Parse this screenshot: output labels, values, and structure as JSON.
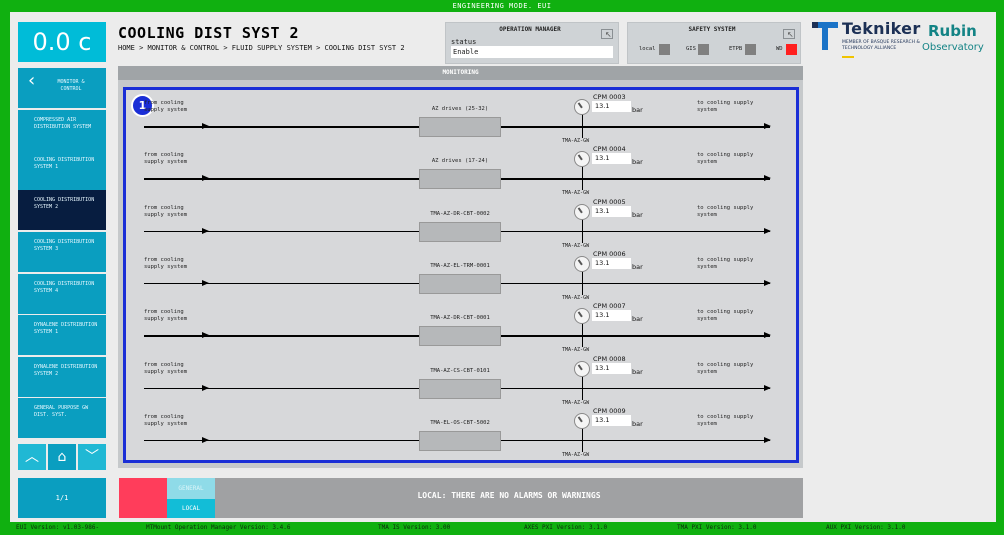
{
  "top_bar": {
    "title": "ENGINEERING MODE. EUI"
  },
  "sidebar": {
    "temperature": "0.0 c",
    "back_label": "MONITOR & CONTROL",
    "items": [
      {
        "label": "COMPRESSED AIR DISTRIBUTION SYSTEM",
        "active": false
      },
      {
        "label": "COOLING DISTRIBUTION SYSTEM 1",
        "active": false
      },
      {
        "label": "COOLING DISTRIBUTION SYSTEM 2",
        "active": true
      },
      {
        "label": "COOLING DISTRIBUTION SYSTEM 3",
        "active": false
      },
      {
        "label": "COOLING DISTRIBUTION SYSTEM 4",
        "active": false
      },
      {
        "label": "DYNALENE DISTRIBUTION SYSTEM 1",
        "active": false
      },
      {
        "label": "DYNALENE DISTRIBUTION SYSTEM 2",
        "active": false
      },
      {
        "label": "GENERAL PURPOSE GW DIST. SYST.",
        "active": false
      }
    ],
    "page_indicator": "1/1"
  },
  "header": {
    "title": "COOLING DIST SYST 2",
    "breadcrumb": "HOME > MONITOR & CONTROL > FLUID SUPPLY SYSTEM > COOLING DIST SYST 2"
  },
  "operation_manager": {
    "title": "OPERATION MANAGER",
    "status_label": "status",
    "status_value": "Enable"
  },
  "safety_system": {
    "title": "SAFETY SYSTEM",
    "indicators": [
      {
        "label": "local",
        "color": "#808080"
      },
      {
        "label": "GIS",
        "color": "#808080"
      },
      {
        "label": "ETPB",
        "color": "#808080"
      },
      {
        "label": "WD",
        "color": "#ff1f1f"
      }
    ]
  },
  "logos": {
    "tekniker_name": "Tekniker",
    "tekniker_sub": "MEMBER OF BASQUE RESEARCH & TECHNOLOGY ALLIANCE",
    "rubin_1": "Rubin",
    "rubin_2": "Observatory"
  },
  "monitoring": {
    "title": "MONITORING",
    "badge": "1",
    "rows": [
      {
        "from": "from cooling supply system",
        "device": "AZ drives (25-32)",
        "gauge_label": "TMA-AZ-GW",
        "sensor": "CPM 0003",
        "value": "13.1",
        "unit": "bar",
        "to": "to cooling supply system"
      },
      {
        "from": "from cooling supply system",
        "device": "AZ drives (17-24)",
        "gauge_label": "TMA-AZ-GW",
        "sensor": "CPM 0004",
        "value": "13.1",
        "unit": "bar",
        "to": "to cooling supply system"
      },
      {
        "from": "from cooling supply system",
        "device": "TMA-AZ-DR-CBT-0002",
        "gauge_label": "TMA-AZ-GW",
        "sensor": "CPM 0005",
        "value": "13.1",
        "unit": "bar",
        "to": "to cooling supply system"
      },
      {
        "from": "from cooling supply system",
        "device": "TMA-AZ-EL-TRM-0001",
        "gauge_label": "TMA-AZ-GW",
        "sensor": "CPM 0006",
        "value": "13.1",
        "unit": "bar",
        "to": "to cooling supply system"
      },
      {
        "from": "from cooling supply system",
        "device": "TMA-AZ-DR-CBT-0001",
        "gauge_label": "TMA-AZ-GW",
        "sensor": "CPM 0007",
        "value": "13.1",
        "unit": "bar",
        "to": "to cooling supply system"
      },
      {
        "from": "from cooling supply system",
        "device": "TMA-AZ-CS-CBT-0101",
        "gauge_label": "TMA-AZ-GW",
        "sensor": "CPM 0008",
        "value": "13.1",
        "unit": "bar",
        "to": "to cooling supply system"
      },
      {
        "from": "from cooling supply system",
        "device": "TMA-EL-OS-CBT-5002",
        "gauge_label": "TMA-AZ-GW",
        "sensor": "CPM 0009",
        "value": "13.1",
        "unit": "bar",
        "to": "to cooling supply system"
      }
    ]
  },
  "alarms": {
    "tab_general": "GENERAL",
    "tab_local": "LOCAL",
    "message": "LOCAL: THERE ARE NO ALARMS OR WARNINGS"
  },
  "footer": {
    "items": [
      "EUI Version: v1.03-986-",
      "MTMount Operation Manager Version: 3.4.6",
      "TMA IS Version: 3.00",
      "AXES PXI Version: 3.1.0",
      "TMA PXI Version: 3.1.0",
      "AUX PXI Version: 3.1.0"
    ]
  },
  "colors": {
    "frame_green": "#10b010",
    "accent_cyan": "#00bcd8",
    "nav_blue": "#0a9ec0",
    "active_nav": "#071d40",
    "monitor_border": "#1a2ed6",
    "alarm_red": "#ff3d5b"
  }
}
